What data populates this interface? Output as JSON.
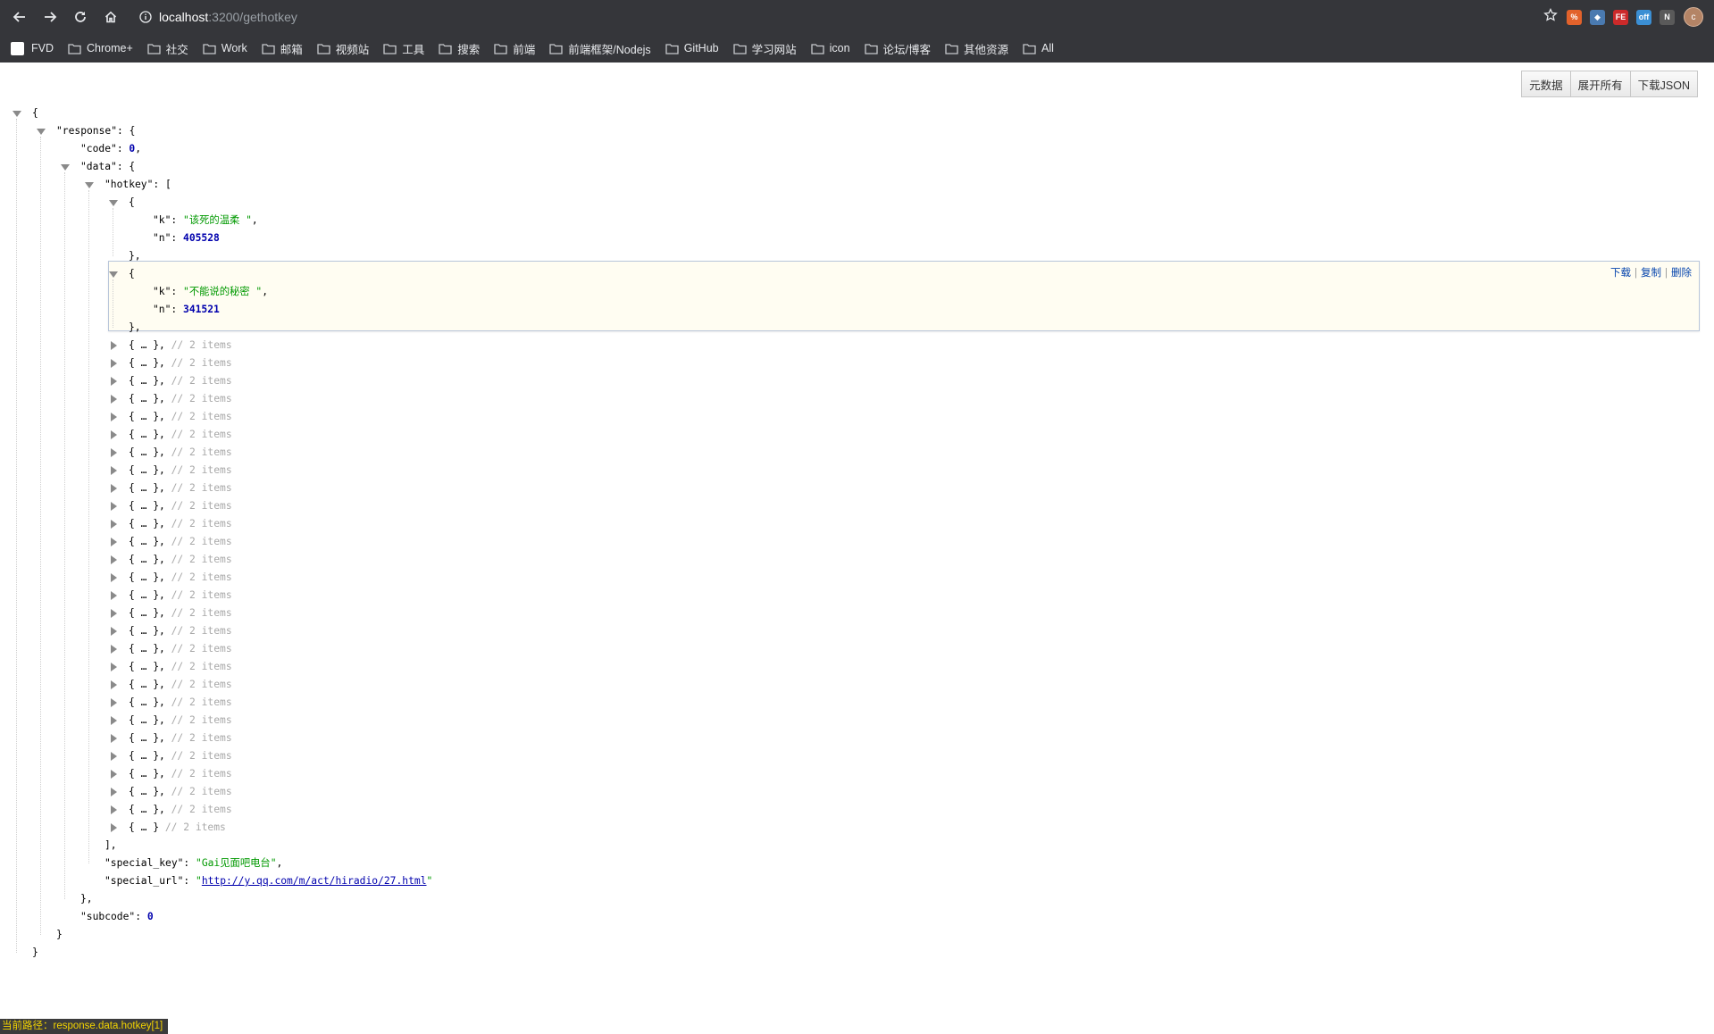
{
  "browser": {
    "url_host": "localhost",
    "url_path": ":3200/gethotkey",
    "bookmarks": [
      {
        "label": "FVD",
        "type": "page"
      },
      {
        "label": "Chrome+",
        "type": "folder"
      },
      {
        "label": "社交",
        "type": "folder"
      },
      {
        "label": "Work",
        "type": "folder"
      },
      {
        "label": "邮箱",
        "type": "folder"
      },
      {
        "label": "视频站",
        "type": "folder"
      },
      {
        "label": "工具",
        "type": "folder"
      },
      {
        "label": "搜索",
        "type": "folder"
      },
      {
        "label": "前端",
        "type": "folder"
      },
      {
        "label": "前端框架/Nodejs",
        "type": "folder"
      },
      {
        "label": "GitHub",
        "type": "folder"
      },
      {
        "label": "学习网站",
        "type": "folder"
      },
      {
        "label": "icon",
        "type": "folder"
      },
      {
        "label": "论坛/博客",
        "type": "folder"
      },
      {
        "label": "其他资源",
        "type": "folder"
      },
      {
        "label": "All",
        "type": "folder"
      }
    ],
    "extensions": [
      {
        "name": "extension-icon-1",
        "text": "%",
        "color": "#e2622b"
      },
      {
        "name": "extension-icon-2",
        "text": "◆",
        "color": "#4a7ab0"
      },
      {
        "name": "extension-icon-3",
        "text": "FE",
        "color": "#cc2a2a"
      },
      {
        "name": "extension-icon-4",
        "text": "off",
        "color": "#3b8fd4"
      },
      {
        "name": "extension-icon-5",
        "text": "N",
        "color": "#5a5a5a"
      }
    ],
    "avatar_letter": "c"
  },
  "viewer": {
    "buttons": [
      "元数据",
      "展开所有",
      "下载JSON"
    ],
    "actions": [
      "下载",
      "复制",
      "删除"
    ],
    "status": "当前路径：response.data.hotkey[1]"
  },
  "json": {
    "response_key": "\"response\"",
    "code_key": "\"code\"",
    "code_value": "0",
    "data_key": "\"data\"",
    "hotkey_key": "\"hotkey\"",
    "k_key": "\"k\"",
    "n_key": "\"n\"",
    "items": [
      {
        "k": "\"该死的温柔 \"",
        "n": "405528"
      },
      {
        "k": "\"不能说的秘密 \"",
        "n": "341521"
      }
    ],
    "collapsed_text": "{ … }",
    "collapsed_comment": "// 2 items",
    "collapsed_count": 28,
    "special_key_key": "\"special_key\"",
    "special_key_value": "\"Gai见面吧电台\"",
    "special_url_key": "\"special_url\"",
    "special_url_value": "http://y.qq.com/m/act/hiradio/27.html",
    "quote": "\"",
    "subcode_key": "\"subcode\"",
    "subcode_value": "0"
  }
}
